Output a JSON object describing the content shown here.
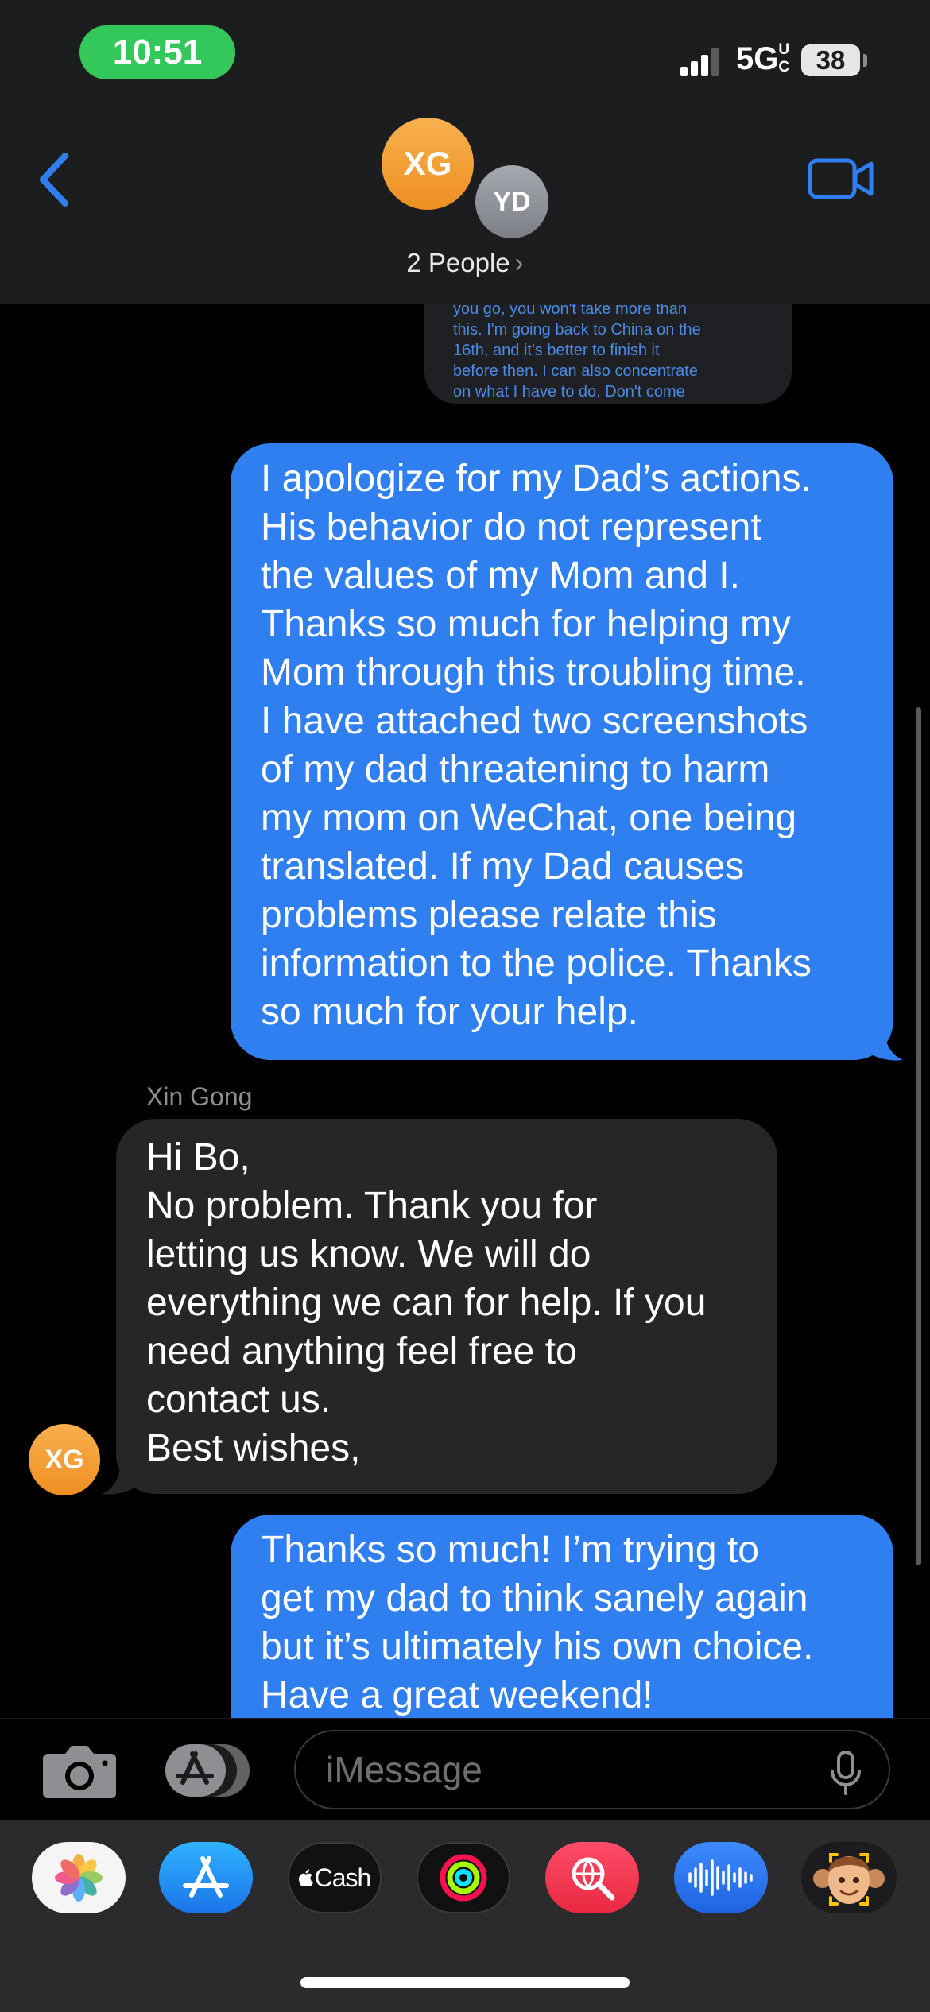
{
  "status_bar": {
    "time": "10:51",
    "network": "5G",
    "network_suffix": "UC",
    "battery": "38"
  },
  "header": {
    "avatars": [
      {
        "initials": "XG",
        "color": "#f0a030"
      },
      {
        "initials": "YD",
        "color": "#8e9096"
      }
    ],
    "participants_label": "2 People",
    "chevron": "›"
  },
  "messages": {
    "previous_snippet": "you go, you won't take more than\nthis. I'm going back to China on the\n16th, and it's better to finish it\nbefore then. I can also concentrate\non what I have to do. Don't come",
    "outgoing_1": "I apologize for my Dad’s actions.\nHis behavior do not represent\nthe values of my Mom and I.\nThanks so much for helping my\nMom through this troubling time.\nI have attached two screenshots\nof my dad threatening to harm\nmy mom on WeChat, one being\ntranslated. If my Dad causes\nproblems please relate this\ninformation to the police. Thanks\nso much for your help.",
    "incoming_sender": "Xin Gong",
    "incoming_avatar": "XG",
    "incoming_1": "Hi Bo,\nNo problem. Thank you for\nletting us know. We will do\neverything we can for help. If you\nneed anything feel free to\ncontact us.\nBest wishes,",
    "outgoing_2": "Thanks so much! I’m trying to\nget my dad to think sanely again\nbut it’s ultimately his own choice.\nHave a great weekend!"
  },
  "compose": {
    "placeholder": "iMessage"
  },
  "app_drawer": {
    "items": [
      {
        "name": "Photos",
        "icon": "photos-icon"
      },
      {
        "name": "App Store",
        "icon": "app-store-icon"
      },
      {
        "name": "Cash",
        "label": "Cash",
        "icon": "apple-cash-icon"
      },
      {
        "name": "Activity",
        "icon": "activity-rings-icon"
      },
      {
        "name": "Images",
        "icon": "image-search-icon"
      },
      {
        "name": "Audio",
        "icon": "audio-waveform-icon"
      },
      {
        "name": "Memoji",
        "icon": "memoji-icon"
      }
    ]
  },
  "colors": {
    "outgoing_bubble": "#2f7ff0",
    "incoming_bubble": "#262628",
    "accent": "#2f7ff0",
    "time_pill": "#34c759"
  }
}
